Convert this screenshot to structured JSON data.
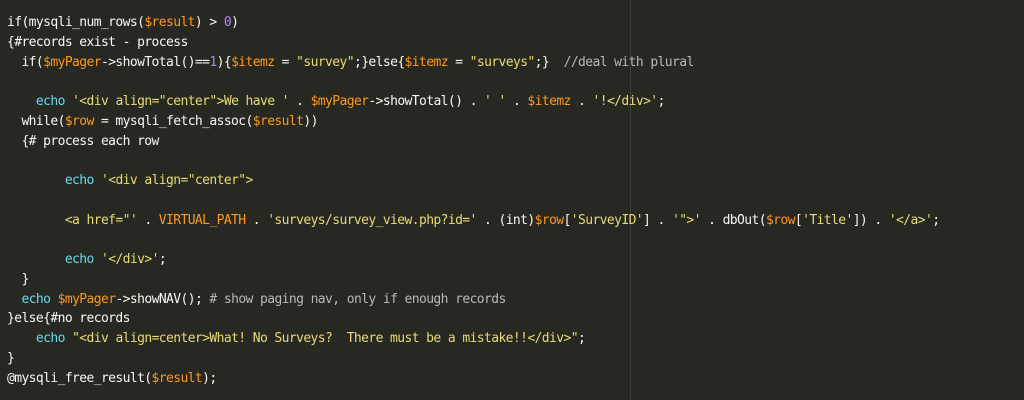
{
  "colors": {
    "background": "#272822",
    "plain": "#f8f8f2",
    "variable": "#fd971f",
    "string": "#e6db74",
    "number": "#ae81ff",
    "function": "#66d9ef",
    "comment": "#b8b8b8"
  },
  "lines": [
    [
      [
        "plain",
        "if(mysqli_num_rows("
      ],
      [
        "var",
        "$result"
      ],
      [
        "plain",
        ") > "
      ],
      [
        "num",
        "0"
      ],
      [
        "plain",
        ")"
      ]
    ],
    [
      [
        "plain",
        "{#records exist - process"
      ]
    ],
    [
      [
        "plain",
        "  if("
      ],
      [
        "var",
        "$myPager"
      ],
      [
        "plain",
        "->showTotal()=="
      ],
      [
        "num",
        "1"
      ],
      [
        "plain",
        "){"
      ],
      [
        "var",
        "$itemz"
      ],
      [
        "plain",
        " = "
      ],
      [
        "str",
        "\"survey\""
      ],
      [
        "plain",
        ";}else{"
      ],
      [
        "var",
        "$itemz"
      ],
      [
        "plain",
        " = "
      ],
      [
        "str",
        "\"surveys\""
      ],
      [
        "plain",
        ";}  "
      ],
      [
        "cm",
        "//deal with plural"
      ]
    ],
    [
      [
        "plain",
        ""
      ]
    ],
    [
      [
        "plain",
        "    "
      ],
      [
        "fn",
        "echo"
      ],
      [
        "plain",
        " "
      ],
      [
        "str",
        "'<div align=\"center\">We have '"
      ],
      [
        "plain",
        " . "
      ],
      [
        "var",
        "$myPager"
      ],
      [
        "plain",
        "->showTotal() . "
      ],
      [
        "str",
        "' '"
      ],
      [
        "plain",
        " . "
      ],
      [
        "var",
        "$itemz"
      ],
      [
        "plain",
        " . "
      ],
      [
        "str",
        "'!</div>'"
      ],
      [
        "plain",
        ";"
      ]
    ],
    [
      [
        "plain",
        "  while("
      ],
      [
        "var",
        "$row"
      ],
      [
        "plain",
        " = mysqli_fetch_assoc("
      ],
      [
        "var",
        "$result"
      ],
      [
        "plain",
        "))"
      ]
    ],
    [
      [
        "plain",
        "  {# process each row"
      ]
    ],
    [
      [
        "plain",
        ""
      ]
    ],
    [
      [
        "plain",
        "        "
      ],
      [
        "fn",
        "echo"
      ],
      [
        "plain",
        " "
      ],
      [
        "str",
        "'<div align=\"center\">"
      ]
    ],
    [
      [
        "plain",
        ""
      ]
    ],
    [
      [
        "str",
        "        <a href=\"'"
      ],
      [
        "plain",
        " . "
      ],
      [
        "const",
        "VIRTUAL_PATH"
      ],
      [
        "plain",
        " . "
      ],
      [
        "str",
        "'surveys/survey_view.php?id='"
      ],
      [
        "plain",
        " . (int)"
      ],
      [
        "var",
        "$row"
      ],
      [
        "plain",
        "["
      ],
      [
        "str",
        "'SurveyID'"
      ],
      [
        "plain",
        "] . "
      ],
      [
        "str",
        "'\">'"
      ],
      [
        "plain",
        " . dbOut("
      ],
      [
        "var",
        "$row"
      ],
      [
        "plain",
        "["
      ],
      [
        "str",
        "'Title'"
      ],
      [
        "plain",
        "]) . "
      ],
      [
        "str",
        "'</a>'"
      ],
      [
        "plain",
        ";"
      ]
    ],
    [
      [
        "plain",
        ""
      ]
    ],
    [
      [
        "plain",
        "        "
      ],
      [
        "fn",
        "echo"
      ],
      [
        "plain",
        " "
      ],
      [
        "str",
        "'</div>'"
      ],
      [
        "plain",
        ";"
      ]
    ],
    [
      [
        "plain",
        "  }"
      ]
    ],
    [
      [
        "plain",
        "  "
      ],
      [
        "fn",
        "echo"
      ],
      [
        "plain",
        " "
      ],
      [
        "var",
        "$myPager"
      ],
      [
        "plain",
        "->showNAV(); "
      ],
      [
        "cm",
        "# show paging nav, only if enough records"
      ]
    ],
    [
      [
        "plain",
        "}else{#no records"
      ]
    ],
    [
      [
        "plain",
        "    "
      ],
      [
        "fn",
        "echo"
      ],
      [
        "plain",
        " "
      ],
      [
        "str",
        "\"<div align=center>What! No Surveys?  There must be a mistake!!</div>\""
      ],
      [
        "plain",
        ";"
      ]
    ],
    [
      [
        "plain",
        "}"
      ]
    ],
    [
      [
        "plain",
        "@mysqli_free_result("
      ],
      [
        "var",
        "$result"
      ],
      [
        "plain",
        ");"
      ]
    ]
  ]
}
